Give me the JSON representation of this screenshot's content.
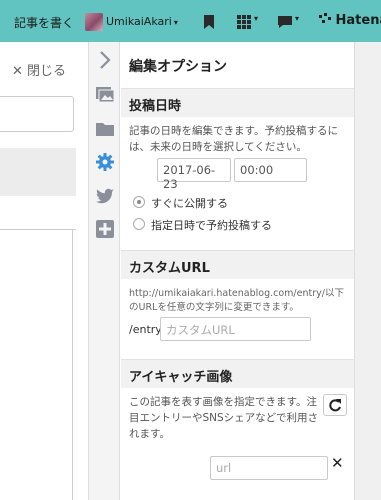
{
  "topbar": {
    "write_label": "記事を書く",
    "user_name": "UmikaiAkari",
    "caret": "▾",
    "brand": "Hatena"
  },
  "editor": {
    "close_label": "✕ 閉じる"
  },
  "panel": {
    "title": "編集オプション",
    "post_date": {
      "heading": "投稿日時",
      "description": "記事の日時を編集できます。予約投稿するには、未来の日時を選択してください。",
      "date_value": "2017-06-23",
      "time_value": "00:00",
      "options": [
        {
          "label": "すぐに公開する",
          "selected": true
        },
        {
          "label": "指定日時で予約投稿する",
          "selected": false
        }
      ]
    },
    "custom_url": {
      "heading": "カスタムURL",
      "description": "http://umikaiakari.hatenablog.com/entry/以下のURLを任意の文字列に変更できます。",
      "prefix": "/entry/",
      "placeholder": "カスタムURL"
    },
    "eyecatch": {
      "heading": "アイキャッチ画像",
      "description": "この記事を表す画像を指定できます。注目エントリーやSNSシェアなどで利用されます。",
      "url_placeholder": "url",
      "clear_label": "✕"
    }
  },
  "rail_icons": [
    "chevron-right-icon",
    "photo-icon",
    "folder-icon",
    "gear-icon",
    "twitter-icon",
    "plus-icon"
  ],
  "colors": {
    "topbar": "#61c4c1",
    "accent_gear": "#3a8fd6",
    "rail_icon": "#8a8f99"
  }
}
